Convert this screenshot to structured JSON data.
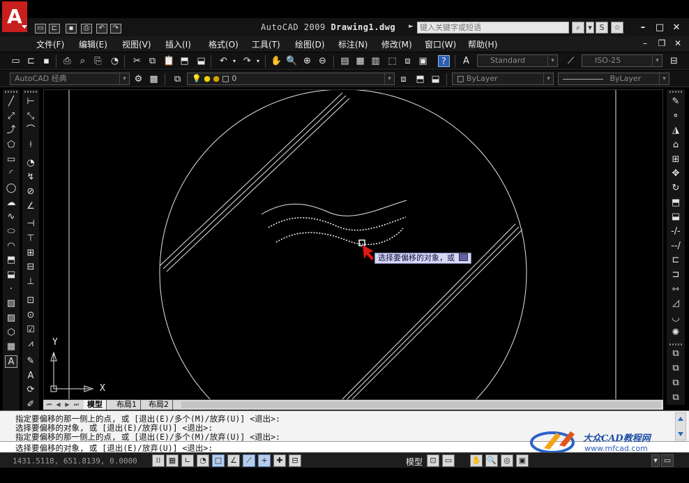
{
  "window": {
    "app_name": "AutoCAD 2009",
    "file_name": "Drawing1.dwg",
    "logo_letter": "A",
    "search_placeholder": "键入关键字或短语"
  },
  "menu": [
    "文件(F)",
    "编辑(E)",
    "视图(V)",
    "插入(I)",
    "格式(O)",
    "工具(T)",
    "绘图(D)",
    "标注(N)",
    "修改(M)",
    "窗口(W)",
    "帮助(H)"
  ],
  "toolbar": {
    "workspace": "AutoCAD 经典",
    "layer_value": "0",
    "text_style": "Standard",
    "dim_style": "ISO-25",
    "color": "ByLayer",
    "linetype": "ByLayer"
  },
  "canvas": {
    "tooltip": "选择要偏移的对象，或",
    "ucs_x": "X",
    "ucs_y": "Y"
  },
  "tabs": [
    "模型",
    "布局1",
    "布局2"
  ],
  "command": {
    "history": [
      "指定要偏移的那一侧上的点, 或 [退出(E)/多个(M)/放弃(U)] <退出>:",
      "选择要偏移的对象, 或 [退出(E)/放弃(U)] <退出>:",
      "指定要偏移的那一侧上的点, 或 [退出(E)/多个(M)/放弃(U)] <退出>:"
    ],
    "prompt": "选择要偏移的对象, 或 [退出(E)/放弃(U)] <退出>:"
  },
  "status": {
    "coords": "1431.5118, 651.8139, 0.0000",
    "model_label": "模型"
  },
  "watermark": {
    "title": "大众CAD教程网",
    "url": "www.mfcad.com"
  }
}
